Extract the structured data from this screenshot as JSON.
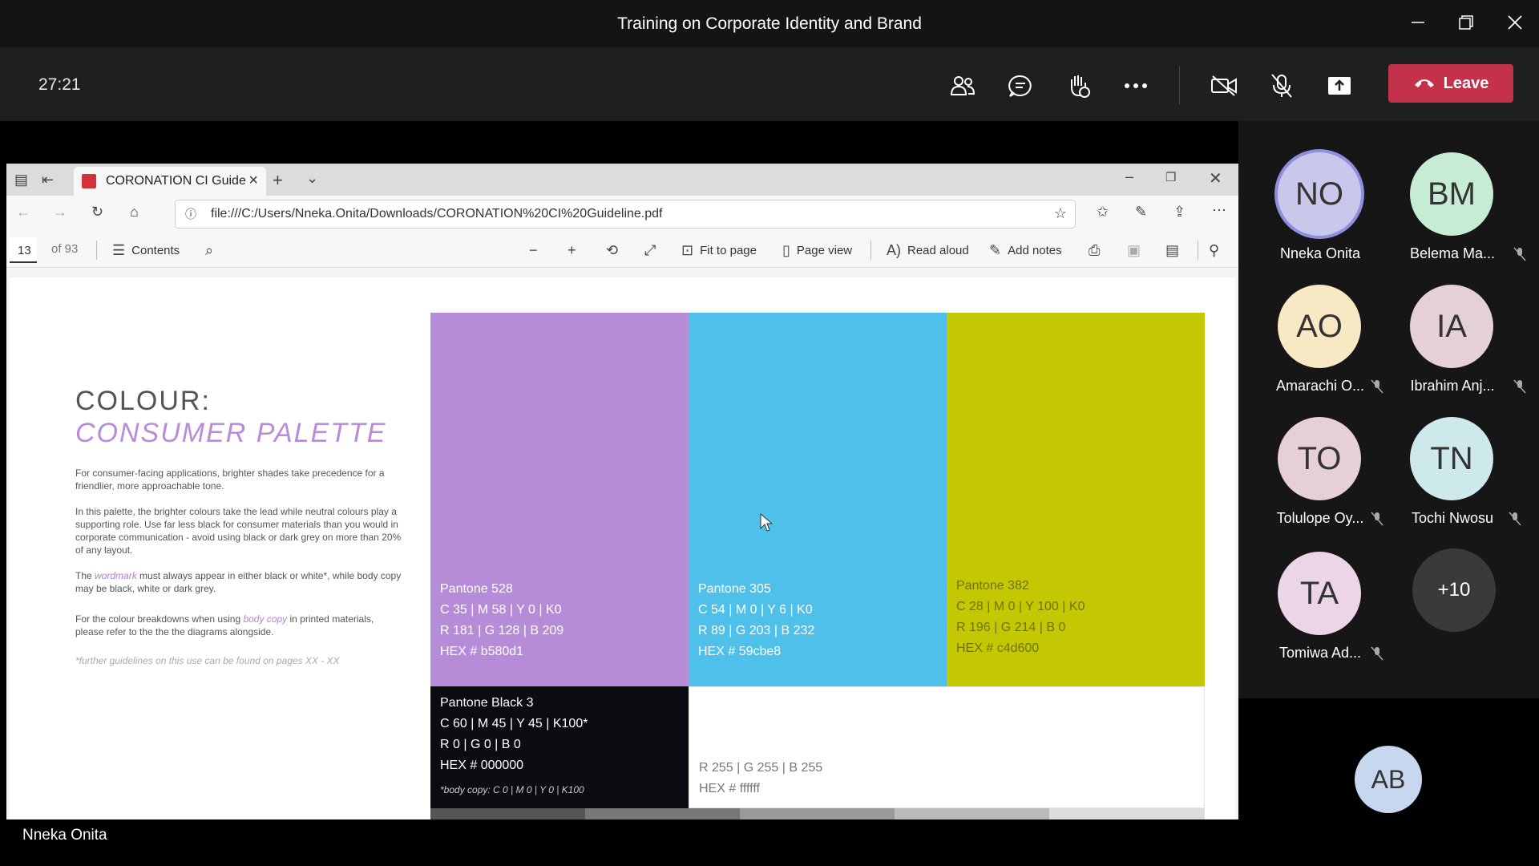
{
  "meeting": {
    "title": "Training on Corporate Identity and Brand",
    "timer": "27:21",
    "leave_label": "Leave",
    "presenter_name": "Nneka Onita"
  },
  "browser": {
    "tab_title": "CORONATION CI Guide",
    "url": "file:///C:/Users/Nneka.Onita/Downloads/CORONATION%20CI%20Guideline.pdf",
    "page_current": "13",
    "page_total": "of 93",
    "contents_label": "Contents",
    "fit_to_page_label": "Fit to page",
    "page_view_label": "Page view",
    "read_aloud_label": "Read aloud",
    "add_notes_label": "Add notes"
  },
  "pdf": {
    "heading_1": "COLOUR:",
    "heading_2": "CONSUMER PALETTE",
    "para_1": "For consumer-facing applications, brighter shades take precedence for a friendlier, more approachable tone.",
    "para_2": "In this palette, the brighter colours take the lead while neutral colours play a supporting role. Use far less black for consumer materials than you would in corporate communication - avoid using black or dark grey on more than 20% of any layout.",
    "para_3_before": "The ",
    "para_3_accent": "wordmark",
    "para_3_after": " must always appear in either black or white*, while body copy may be black, white or dark grey.",
    "para_4_before": "For the colour breakdowns when using ",
    "para_4_accent": "body copy",
    "para_4_after": " in printed materials, please refer to the the the diagrams alongside.",
    "footnote": "*further guidelines on this use can be found on pages XX - XX",
    "swatches": [
      {
        "name": "Pantone 528",
        "cmyk": "C 35 | M 58 | Y 0 | K0",
        "rgb": "R 181 | G 128 | B 209",
        "hex": "HEX # b580d1",
        "color": "#b68bd8",
        "text_color": "#ffffff"
      },
      {
        "name": "Pantone 305",
        "cmyk": "C 54 | M 0 | Y 6 | K0",
        "rgb": "R 89 | G 203 | B 232",
        "hex": "HEX # 59cbe8",
        "color": "#4fc0ea",
        "text_color": "#ffffff"
      },
      {
        "name": "Pantone 382",
        "cmyk": "C 28 | M 0 | Y 100 | K0",
        "rgb": "R 196 | G 214 | B 0",
        "hex": "HEX # c4d600",
        "color": "#c3c803",
        "text_color": "#6f7300"
      },
      {
        "name": "Pantone Black 3",
        "cmyk": "C 60 | M 45 | Y 45 | K100*",
        "rgb": "R 0 | G 0 | B 0",
        "hex": "HEX # 000000",
        "note": "*body copy: C 0 | M 0 | Y 0 | K100",
        "color": "#0b0b12",
        "text_color": "#ffffff"
      },
      {
        "rgb": "R 255 | G 255 | B 255",
        "hex": "HEX # ffffff",
        "color": "#ffffff",
        "text_color": "#777777"
      }
    ],
    "grey_strip": [
      "#555555",
      "#777777",
      "#999999",
      "#bbbbbb",
      "#dddddd"
    ]
  },
  "participants": [
    {
      "initials": "NO",
      "name": "Nneka Onita",
      "color": "#c9c8ea",
      "muted": false,
      "speaking": true
    },
    {
      "initials": "BM",
      "name": "Belema Ma...",
      "color": "#c6ecd4",
      "muted": true
    },
    {
      "initials": "AO",
      "name": "Amarachi O...",
      "color": "#f9e8c4",
      "muted": true
    },
    {
      "initials": "IA",
      "name": "Ibrahim Anj...",
      "color": "#e6d0d7",
      "muted": true
    },
    {
      "initials": "TO",
      "name": "Tolulope Oy...",
      "color": "#e6cfd6",
      "muted": true
    },
    {
      "initials": "TN",
      "name": "Tochi Nwosu",
      "color": "#cde9ec",
      "muted": true
    },
    {
      "initials": "TA",
      "name": "Tomiwa Ad...",
      "color": "#ecd5e7",
      "muted": true
    }
  ],
  "overflow_count": "+10",
  "bottom_participant": "AB"
}
